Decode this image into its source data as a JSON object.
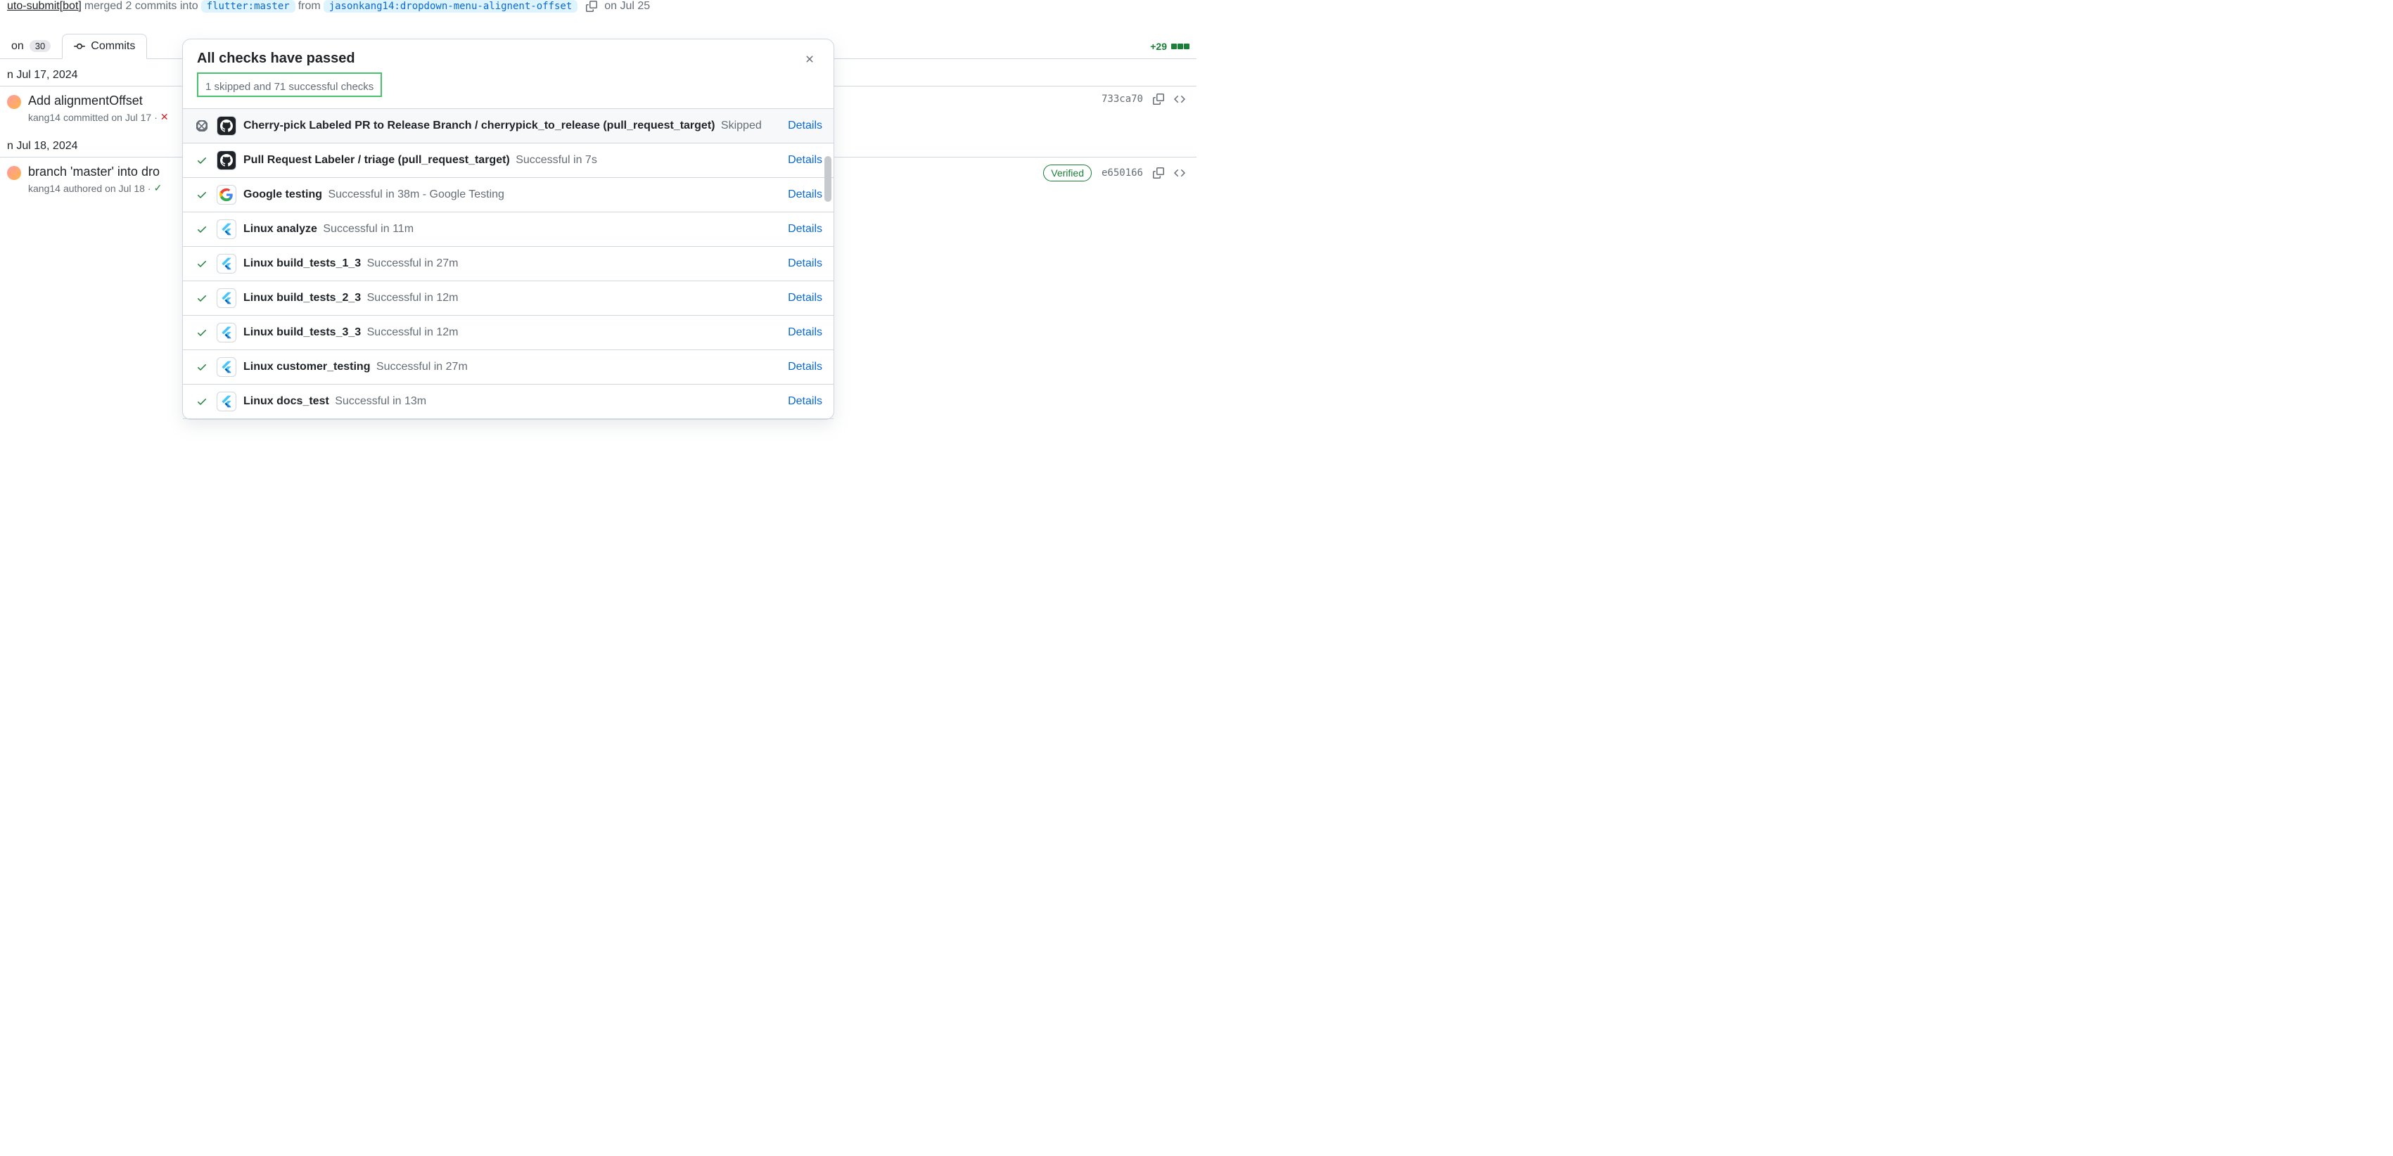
{
  "merge_line": {
    "bot": "uto-submit[bot]",
    "verb": "merged 2 commits into",
    "base": "flutter:master",
    "from": "from",
    "head": "jasonkang14:dropdown-menu-alignent-offset",
    "date": "on Jul 25"
  },
  "tabs": {
    "conversation": {
      "label": "on",
      "count": "30"
    },
    "commits": {
      "label": "Commits"
    }
  },
  "diff": {
    "plus": "+29"
  },
  "dates": {
    "d1": "n Jul 17, 2024",
    "d2": "n Jul 18, 2024"
  },
  "commits": [
    {
      "title": "Add alignmentOffset",
      "author": "kang14",
      "sub": "committed on Jul 17",
      "sha": "733ca70",
      "verified": false
    },
    {
      "title": "branch 'master' into dro",
      "author": "kang14",
      "sub": "authored on Jul 18",
      "sha": "e650166",
      "verified": true
    }
  ],
  "dialog": {
    "title": "All checks have passed",
    "sub": "1 skipped and 71 successful checks",
    "details": "Details",
    "checks": [
      {
        "name": "Cherry-pick Labeled PR to Release Branch / cherrypick_to_release (pull_request_target)",
        "status": "Skipped",
        "icon": "github",
        "state": "skipped"
      },
      {
        "name": "Pull Request Labeler / triage (pull_request_target)",
        "status": "Successful in 7s",
        "icon": "github",
        "state": "success"
      },
      {
        "name": "Google testing",
        "status": "Successful in 38m - Google Testing",
        "icon": "google",
        "state": "success"
      },
      {
        "name": "Linux analyze",
        "status": "Successful in 11m",
        "icon": "flutter",
        "state": "success"
      },
      {
        "name": "Linux build_tests_1_3",
        "status": "Successful in 27m",
        "icon": "flutter",
        "state": "success"
      },
      {
        "name": "Linux build_tests_2_3",
        "status": "Successful in 12m",
        "icon": "flutter",
        "state": "success"
      },
      {
        "name": "Linux build_tests_3_3",
        "status": "Successful in 12m",
        "icon": "flutter",
        "state": "success"
      },
      {
        "name": "Linux customer_testing",
        "status": "Successful in 27m",
        "icon": "flutter",
        "state": "success"
      },
      {
        "name": "Linux docs_test",
        "status": "Successful in 13m",
        "icon": "flutter",
        "state": "success"
      }
    ]
  }
}
